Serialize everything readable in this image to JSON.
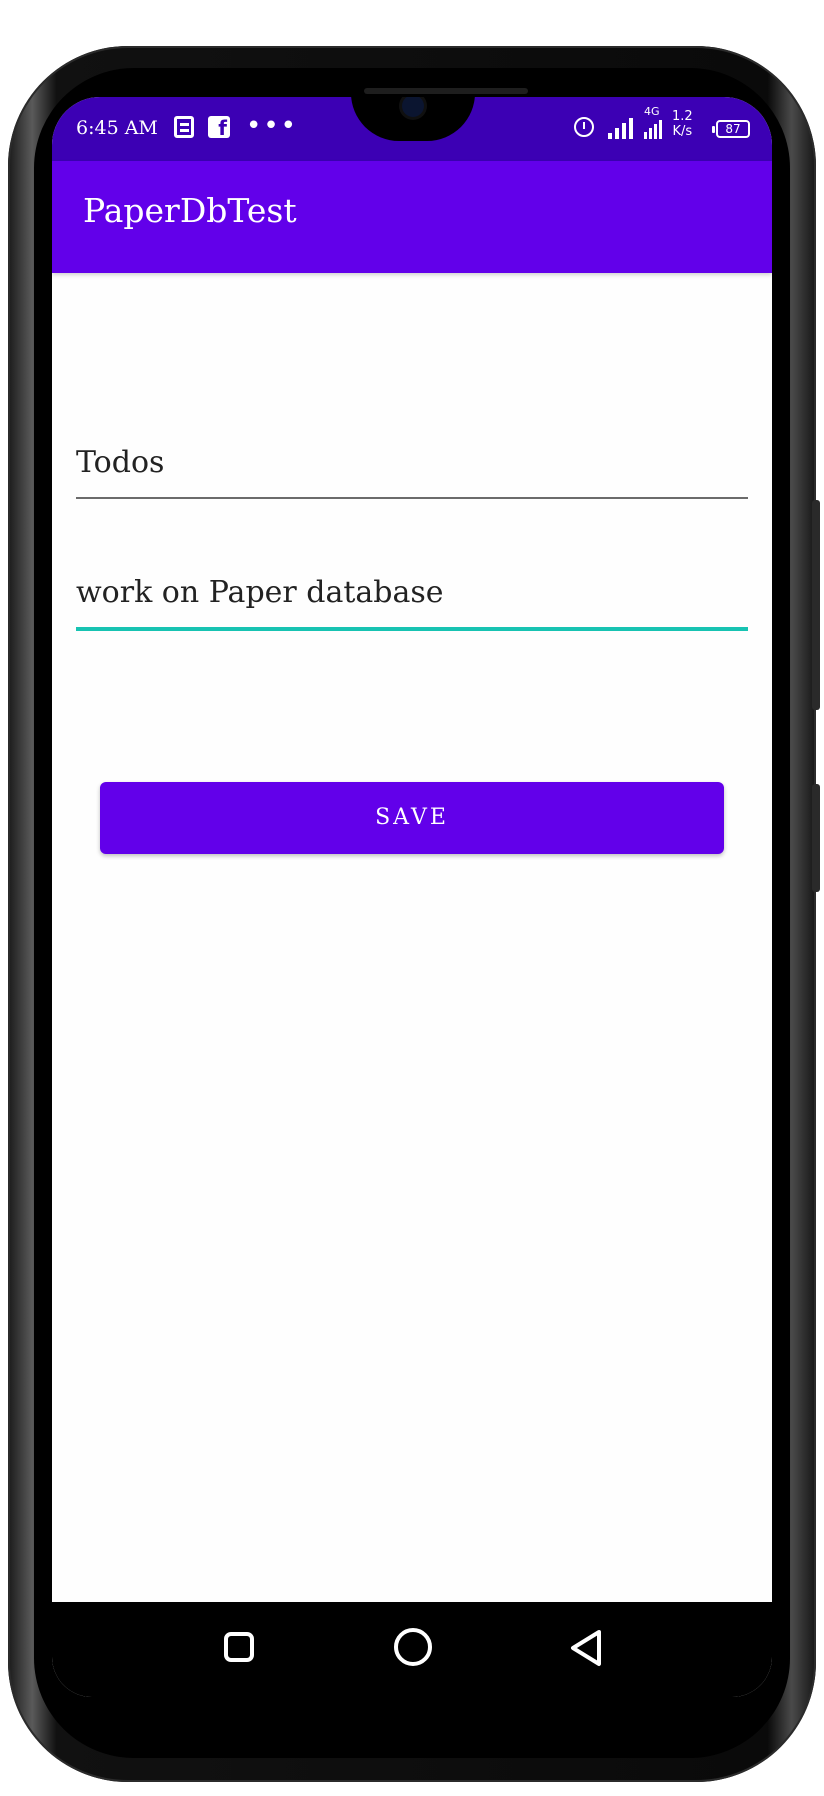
{
  "status_bar": {
    "time": "6:45 AM",
    "network_type": "4G",
    "speed_value": "1.2",
    "speed_unit": "K/s",
    "battery": "87",
    "icons": [
      "news-icon",
      "facebook-icon",
      "more-notifications-icon",
      "alarm-icon",
      "signal-icon",
      "signal-icon-2",
      "battery-icon"
    ]
  },
  "app_bar": {
    "title": "PaperDbTest"
  },
  "form": {
    "key_field_value": "Todos",
    "value_field_value": "work on Paper database",
    "save_label": "SAVE"
  },
  "nav_bar": {
    "icons": [
      "recents-square-icon",
      "home-circle-icon",
      "back-triangle-icon"
    ]
  },
  "colors": {
    "status_bar": "#3c00b4",
    "primary": "#6200ea",
    "focus_underline": "#17c3b2"
  }
}
